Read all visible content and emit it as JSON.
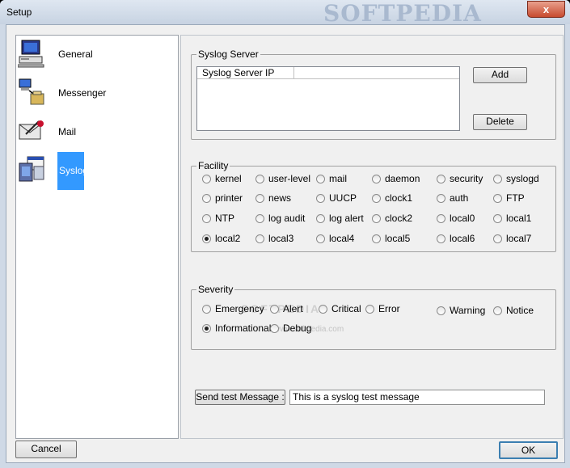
{
  "window": {
    "title": "Setup",
    "close_glyph": "x",
    "watermark": "SOFTPEDIA"
  },
  "nav": {
    "items": [
      {
        "label": "General",
        "icon": "computer-icon"
      },
      {
        "label": "Messenger",
        "icon": "network-messenger-icon"
      },
      {
        "label": "Mail",
        "icon": "mail-envelope-icon"
      },
      {
        "label": "Syslog",
        "icon": "syslog-app-icon",
        "selected": true
      }
    ]
  },
  "syslog_server": {
    "legend": "Syslog Server",
    "column_header": "Syslog Server IP",
    "add_label": "Add",
    "delete_label": "Delete"
  },
  "facility": {
    "legend": "Facility",
    "selected": "local2",
    "rows": [
      [
        "kernel",
        "user-level",
        "mail",
        "daemon",
        "security",
        "syslogd"
      ],
      [
        "printer",
        "news",
        "UUCP",
        "clock1",
        "auth",
        "FTP"
      ],
      [
        "NTP",
        "log audit",
        "log alert",
        "clock2",
        "local0",
        "local1"
      ],
      [
        "local2",
        "local3",
        "local4",
        "local5",
        "local6",
        "local7"
      ]
    ]
  },
  "severity": {
    "legend": "Severity",
    "selected": "Informational",
    "options": [
      "Emergency",
      "Alert",
      "Critical",
      "Error",
      "Warning",
      "Notice",
      "Informational",
      "Debug"
    ]
  },
  "test": {
    "button_label": "Send test Message :",
    "message_value": "This is a syslog test message"
  },
  "footer": {
    "cancel_label": "Cancel",
    "ok_label": "OK"
  },
  "overlay": {
    "watermark": "SOFTPEDIA",
    "url": "www.softpedia.com"
  }
}
